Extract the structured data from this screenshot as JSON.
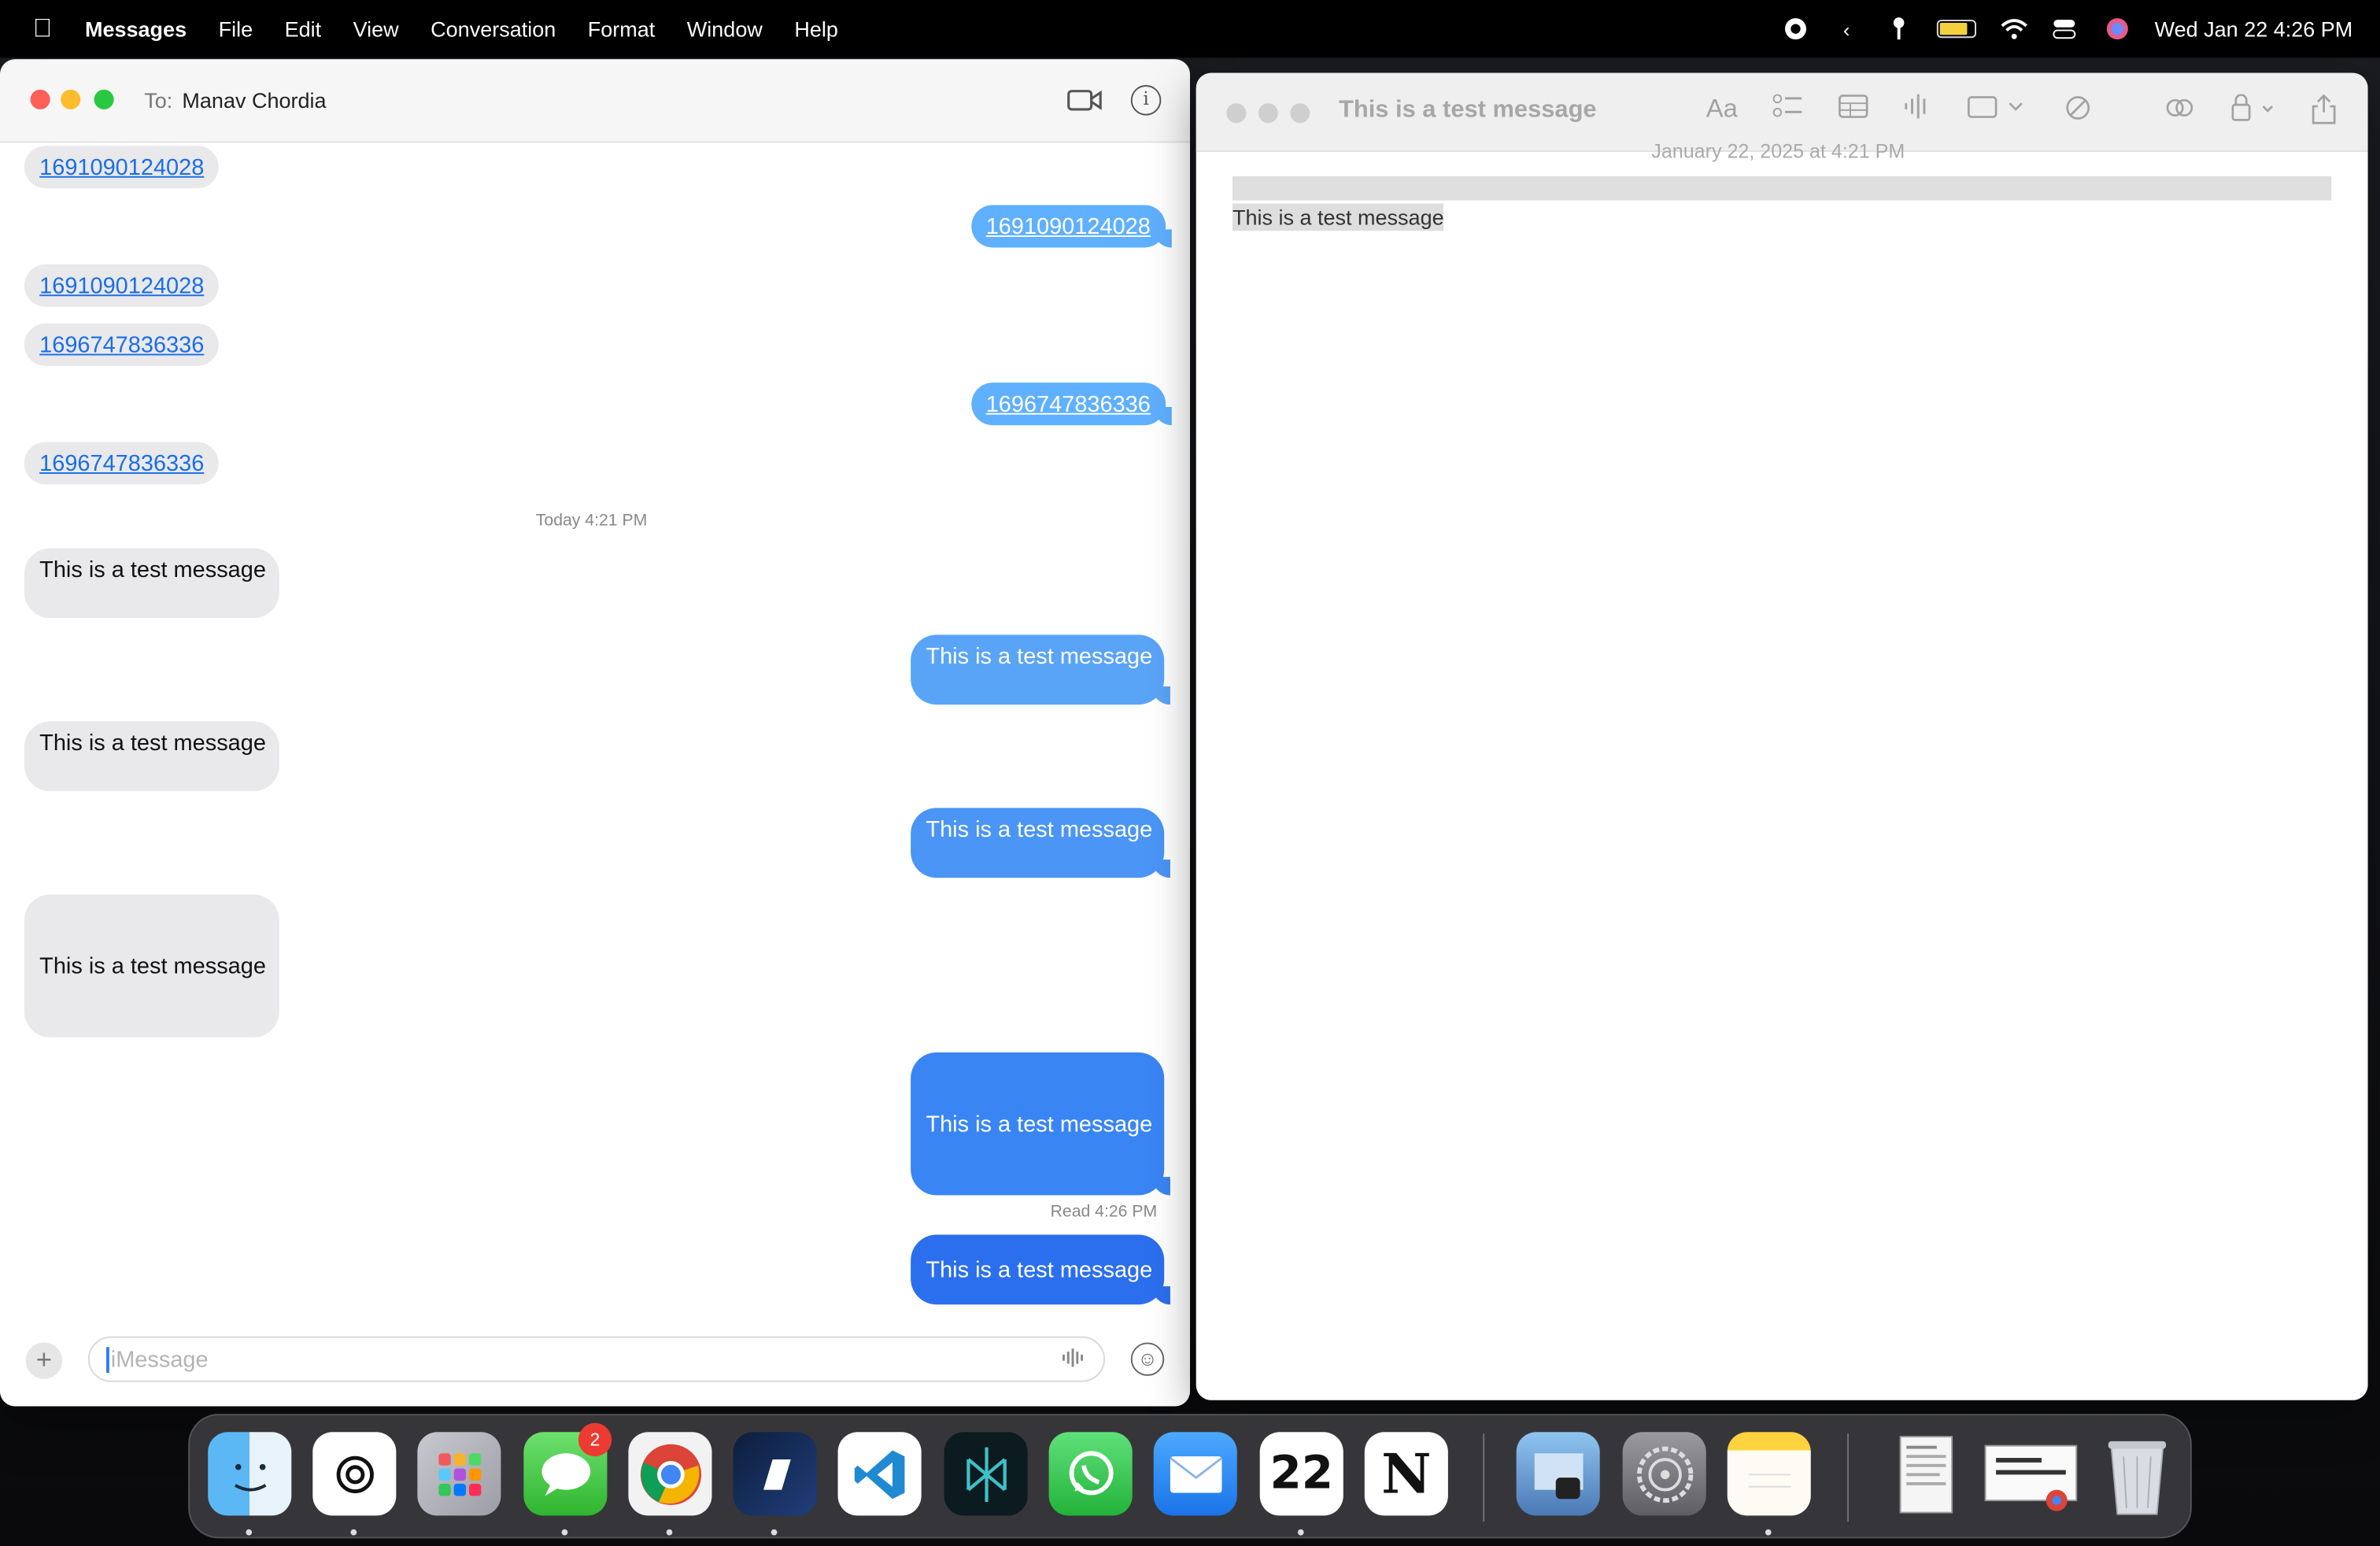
{
  "menubar": {
    "app_name": "Messages",
    "items": [
      "File",
      "Edit",
      "View",
      "Conversation",
      "Format",
      "Window",
      "Help"
    ],
    "clock": "Wed Jan 22  4:26 PM",
    "battery_level": 0.85
  },
  "messages": {
    "to_label": "To:",
    "recipient": "Manav Chordia",
    "timestamp": "Today 4:21 PM",
    "read_receipt": "Read 4:26 PM",
    "bubbles": [
      {
        "text": "1691090124028",
        "dir": "in",
        "link": true
      },
      {
        "text": "1691090124028",
        "dir": "out",
        "link": true
      },
      {
        "text": "1691090124028",
        "dir": "in",
        "link": true
      },
      {
        "text": "1696747836336",
        "dir": "in",
        "link": true
      },
      {
        "text": "1696747836336",
        "dir": "out",
        "link": true
      },
      {
        "text": "1696747836336",
        "dir": "in",
        "link": true
      },
      {
        "text": "This is a test message",
        "dir": "in"
      },
      {
        "text": "This is a test message",
        "dir": "out"
      },
      {
        "text": "This is a test message",
        "dir": "in"
      },
      {
        "text": "This is a test message",
        "dir": "out"
      },
      {
        "text": "This is a test message",
        "dir": "in"
      },
      {
        "text": "This is a test message",
        "dir": "out"
      },
      {
        "text": "This is a test message",
        "dir": "out"
      }
    ],
    "compose_placeholder": "iMessage",
    "colors": {
      "incoming": "#e9e9eb",
      "outgoing_light": "#5fb0ff",
      "outgoing": "#3a85f4",
      "outgoing_dark": "#2b6fee"
    }
  },
  "notes": {
    "title": "This is a test message",
    "date_line": "January 22, 2025 at 4:21 PM",
    "body": "This is a test message",
    "tool_aa": "Aa"
  },
  "dock": {
    "apps": [
      {
        "name": "Finder",
        "icon": "finder-icon",
        "running": true
      },
      {
        "name": "ChatGPT",
        "icon": "chatgpt-icon",
        "running": true
      },
      {
        "name": "Launchpad",
        "icon": "launchpad-icon",
        "running": false
      },
      {
        "name": "Messages",
        "icon": "messages-icon",
        "running": true,
        "badge": "2"
      },
      {
        "name": "Chrome",
        "icon": "chrome-icon",
        "running": true
      },
      {
        "name": "Linear",
        "icon": "linear-icon",
        "running": true
      },
      {
        "name": "VS Code",
        "icon": "vscode-icon",
        "running": false
      },
      {
        "name": "Perplexity",
        "icon": "perplexity-icon",
        "running": false
      },
      {
        "name": "WhatsApp",
        "icon": "whatsapp-icon",
        "running": false
      },
      {
        "name": "Mail",
        "icon": "mail-icon",
        "running": false
      },
      {
        "name": "Calendar",
        "icon": "calendar-icon",
        "running": true,
        "label": "22"
      },
      {
        "name": "Notion",
        "icon": "notion-icon",
        "running": false,
        "label": "N"
      },
      {
        "name": "Preview",
        "icon": "preview-icon",
        "running": false
      },
      {
        "name": "System Settings",
        "icon": "settings-icon",
        "running": false
      },
      {
        "name": "Notes",
        "icon": "notes-icon",
        "running": true
      },
      {
        "name": "Document",
        "icon": "document-icon",
        "running": false
      },
      {
        "name": "Chrome Window",
        "icon": "chrome-window-icon",
        "running": false
      },
      {
        "name": "Trash",
        "icon": "trash-icon",
        "running": false
      }
    ]
  }
}
